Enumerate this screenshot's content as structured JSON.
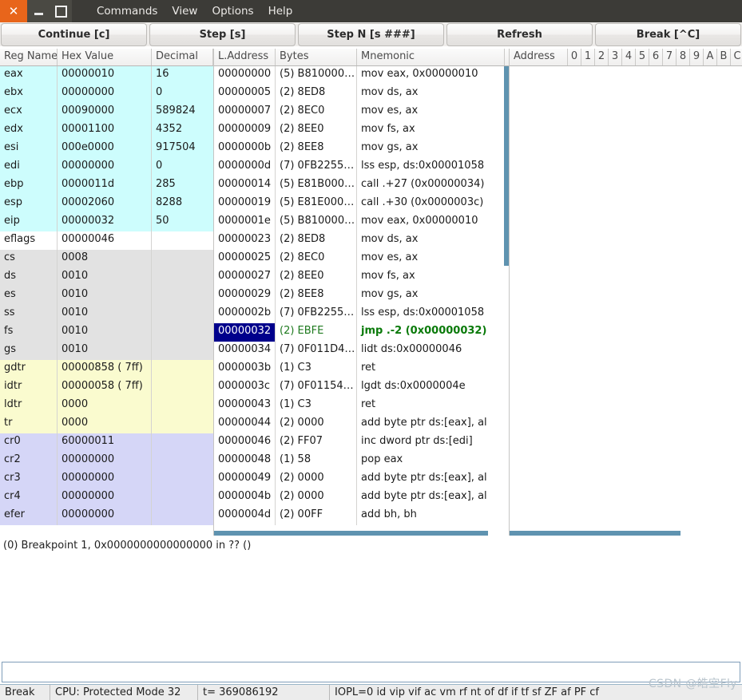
{
  "window": {
    "close_label": "✕",
    "minimize_label": "",
    "maximize_label": "",
    "menu": [
      {
        "label": "Commands"
      },
      {
        "label": "View"
      },
      {
        "label": "Options"
      },
      {
        "label": "Help"
      }
    ]
  },
  "toolbar": {
    "buttons": [
      {
        "label": "Continue [c]"
      },
      {
        "label": "Step [s]"
      },
      {
        "label": "Step N [s ###]"
      },
      {
        "label": "Refresh"
      },
      {
        "label": "Break [^C]"
      }
    ]
  },
  "registers": {
    "headers": [
      "Reg Name",
      "Hex Value",
      "Decimal"
    ],
    "rows": [
      {
        "group": "gp",
        "name": "eax",
        "hex": "00000010",
        "dec": "16"
      },
      {
        "group": "gp",
        "name": "ebx",
        "hex": "00000000",
        "dec": "0"
      },
      {
        "group": "gp",
        "name": "ecx",
        "hex": "00090000",
        "dec": "589824"
      },
      {
        "group": "gp",
        "name": "edx",
        "hex": "00001100",
        "dec": "4352"
      },
      {
        "group": "gp",
        "name": "esi",
        "hex": "000e0000",
        "dec": "917504"
      },
      {
        "group": "gp",
        "name": "edi",
        "hex": "00000000",
        "dec": "0"
      },
      {
        "group": "gp",
        "name": "ebp",
        "hex": "0000011d",
        "dec": "285"
      },
      {
        "group": "gp",
        "name": "esp",
        "hex": "00002060",
        "dec": "8288"
      },
      {
        "group": "gp",
        "name": "eip",
        "hex": "00000032",
        "dec": "50"
      },
      {
        "group": "flag",
        "name": "eflags",
        "hex": "00000046",
        "dec": ""
      },
      {
        "group": "seg",
        "name": "cs",
        "hex": "0008",
        "dec": ""
      },
      {
        "group": "seg",
        "name": "ds",
        "hex": "0010",
        "dec": ""
      },
      {
        "group": "seg",
        "name": "es",
        "hex": "0010",
        "dec": ""
      },
      {
        "group": "seg",
        "name": "ss",
        "hex": "0010",
        "dec": ""
      },
      {
        "group": "seg",
        "name": "fs",
        "hex": "0010",
        "dec": ""
      },
      {
        "group": "seg",
        "name": "gs",
        "hex": "0010",
        "dec": ""
      },
      {
        "group": "desc",
        "name": "gdtr",
        "hex": "00000858 ( 7ff)",
        "dec": ""
      },
      {
        "group": "desc",
        "name": "idtr",
        "hex": "00000058 ( 7ff)",
        "dec": ""
      },
      {
        "group": "desc",
        "name": "ldtr",
        "hex": "0000",
        "dec": ""
      },
      {
        "group": "desc",
        "name": "tr",
        "hex": "0000",
        "dec": ""
      },
      {
        "group": "ctrl",
        "name": "cr0",
        "hex": "60000011",
        "dec": ""
      },
      {
        "group": "ctrl",
        "name": "cr2",
        "hex": "00000000",
        "dec": ""
      },
      {
        "group": "ctrl",
        "name": "cr3",
        "hex": "00000000",
        "dec": ""
      },
      {
        "group": "ctrl",
        "name": "cr4",
        "hex": "00000000",
        "dec": ""
      },
      {
        "group": "ctrl",
        "name": "efer",
        "hex": "00000000",
        "dec": ""
      }
    ]
  },
  "disassembly": {
    "headers": [
      "L.Address",
      "Bytes",
      "Mnemonic"
    ],
    "rows": [
      {
        "address": "00000000",
        "bytes": "(5) B810000…",
        "mnemonic": "mov eax, 0x00000010",
        "current": false
      },
      {
        "address": "00000005",
        "bytes": "(2) 8ED8",
        "mnemonic": "mov ds, ax",
        "current": false
      },
      {
        "address": "00000007",
        "bytes": "(2) 8EC0",
        "mnemonic": "mov es, ax",
        "current": false
      },
      {
        "address": "00000009",
        "bytes": "(2) 8EE0",
        "mnemonic": "mov fs, ax",
        "current": false
      },
      {
        "address": "0000000b",
        "bytes": "(2) 8EE8",
        "mnemonic": "mov gs, ax",
        "current": false
      },
      {
        "address": "0000000d",
        "bytes": "(7) 0FB2255…",
        "mnemonic": "lss esp, ds:0x00001058",
        "current": false
      },
      {
        "address": "00000014",
        "bytes": "(5) E81B000…",
        "mnemonic": "call .+27 (0x00000034)",
        "current": false
      },
      {
        "address": "00000019",
        "bytes": "(5) E81E000…",
        "mnemonic": "call .+30 (0x0000003c)",
        "current": false
      },
      {
        "address": "0000001e",
        "bytes": "(5) B810000…",
        "mnemonic": "mov eax, 0x00000010",
        "current": false
      },
      {
        "address": "00000023",
        "bytes": "(2) 8ED8",
        "mnemonic": "mov ds, ax",
        "current": false
      },
      {
        "address": "00000025",
        "bytes": "(2) 8EC0",
        "mnemonic": "mov es, ax",
        "current": false
      },
      {
        "address": "00000027",
        "bytes": "(2) 8EE0",
        "mnemonic": "mov fs, ax",
        "current": false
      },
      {
        "address": "00000029",
        "bytes": "(2) 8EE8",
        "mnemonic": "mov gs, ax",
        "current": false
      },
      {
        "address": "0000002b",
        "bytes": "(7) 0FB2255…",
        "mnemonic": "lss esp, ds:0x00001058",
        "current": false
      },
      {
        "address": "00000032",
        "bytes": "(2) EBFE",
        "mnemonic": "jmp .-2 (0x00000032)",
        "current": true
      },
      {
        "address": "00000034",
        "bytes": "(7) 0F011D4…",
        "mnemonic": "lidt ds:0x00000046",
        "current": false
      },
      {
        "address": "0000003b",
        "bytes": "(1) C3",
        "mnemonic": "ret",
        "current": false
      },
      {
        "address": "0000003c",
        "bytes": "(7) 0F01154…",
        "mnemonic": "lgdt ds:0x0000004e",
        "current": false
      },
      {
        "address": "00000043",
        "bytes": "(1) C3",
        "mnemonic": "ret",
        "current": false
      },
      {
        "address": "00000044",
        "bytes": "(2) 0000",
        "mnemonic": "add byte ptr ds:[eax], al",
        "current": false
      },
      {
        "address": "00000046",
        "bytes": "(2) FF07",
        "mnemonic": "inc dword ptr ds:[edi]",
        "current": false
      },
      {
        "address": "00000048",
        "bytes": "(1) 58",
        "mnemonic": "pop eax",
        "current": false
      },
      {
        "address": "00000049",
        "bytes": "(2) 0000",
        "mnemonic": "add byte ptr ds:[eax], al",
        "current": false
      },
      {
        "address": "0000004b",
        "bytes": "(2) 0000",
        "mnemonic": "add byte ptr ds:[eax], al",
        "current": false
      },
      {
        "address": "0000004d",
        "bytes": "(2) 00FF",
        "mnemonic": "add bh, bh",
        "current": false
      }
    ]
  },
  "memory": {
    "headers": [
      "Address",
      "0",
      "1",
      "2",
      "3",
      "4",
      "5",
      "6",
      "7",
      "8",
      "9",
      "A",
      "B",
      "C"
    ],
    "rows": []
  },
  "log": {
    "lines": [
      "(0) Breakpoint 1, 0x0000000000000000 in ?? ()"
    ]
  },
  "command": {
    "value": "",
    "placeholder": ""
  },
  "statusbar": {
    "state": "Break",
    "cpu": "CPU: Protected Mode 32",
    "ticks": "t= 369086192",
    "flags": "IOPL=0 id vip vif ac vm rf nt of df if tf sf ZF af PF cf"
  },
  "watermark": {
    "text": "CSDN @皓空Fly"
  }
}
